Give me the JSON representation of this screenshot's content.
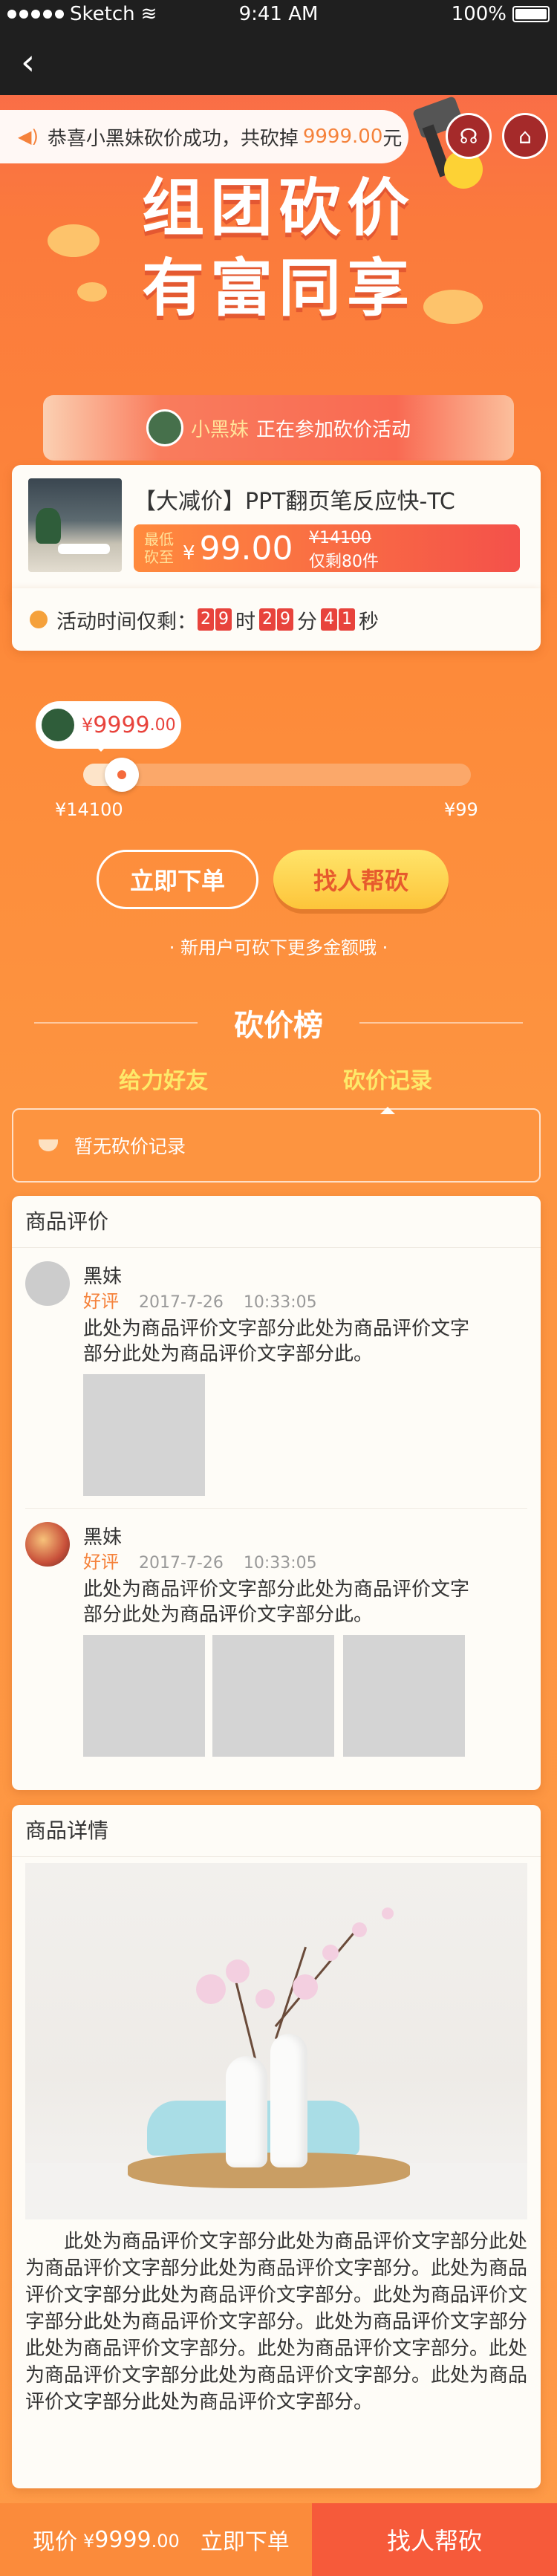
{
  "status_bar": {
    "carrier": "Sketch",
    "time": "9:41 AM",
    "battery": "100%"
  },
  "notice": {
    "text": "恭喜小黑妹砍价成功，共砍掉",
    "amount": "9999.00",
    "unit": "元"
  },
  "hero": {
    "line1": "组团砍价",
    "line2": "有富同享"
  },
  "participant": {
    "name": "小黑妹",
    "text": "正在参加砍价活动"
  },
  "product": {
    "title": "【大减价】PPT翻页笔反应快-TC",
    "lowest_label_1": "最低",
    "lowest_label_2": "砍至",
    "currency": "¥",
    "price": "99.00",
    "original_price": "¥14100",
    "stock": "仅剩80件"
  },
  "timer": {
    "label": "活动时间仅剩：",
    "hours": [
      "2",
      "9"
    ],
    "minutes": [
      "2",
      "9"
    ],
    "seconds": [
      "4",
      "1"
    ],
    "u_hour": "时",
    "u_min": "分",
    "u_sec": "秒"
  },
  "progress": {
    "bubble_currency": "¥",
    "bubble_value": "9999",
    "bubble_decimal": ".00",
    "min_label": "¥14100",
    "max_label": "¥99",
    "fraction": 0.07
  },
  "actions": {
    "buy_now": "立即下单",
    "find_help": "找人帮砍",
    "tip": "新用户可砍下更多金额哦"
  },
  "ranking": {
    "title": "砍价榜",
    "tabs": [
      "给力好友",
      "砍价记录"
    ],
    "empty_text": "暂无砍价记录"
  },
  "reviews": {
    "title": "商品评价",
    "items": [
      {
        "name": "黑妹",
        "rating": "好评",
        "date": "2017-7-26",
        "time": "10:33:05",
        "text": "此处为商品评价文字部分此处为商品评价文字部分此处为商品评价文字部分此。"
      },
      {
        "name": "黑妹",
        "rating": "好评",
        "date": "2017-7-26",
        "time": "10:33:05",
        "text": "此处为商品评价文字部分此处为商品评价文字部分此处为商品评价文字部分此。"
      }
    ]
  },
  "details": {
    "title": "商品详情",
    "text": "此处为商品评价文字部分此处为商品评价文字部分此处为商品评价文字部分此处为商品评价文字部分。此处为商品评价文字部分此处为商品评价文字部分。此处为商品评价文字部分此处为商品评价文字部分。此处为商品评价文字部分此处为商品评价文字部分。此处为商品评价文字部分。此处为商品评价文字部分此处为商品评价文字部分。此处为商品评价文字部分此处为商品评价文字部分。"
  },
  "bottom_bar": {
    "current_label": "现价",
    "currency": "¥",
    "price": "9999",
    "decimal": ".00",
    "buy": "立即下单",
    "help": "找人帮砍"
  },
  "colors": {
    "accent": "#f5823b",
    "red": "#e8433c",
    "yellow": "#fde96a"
  },
  "icons": [
    "back-arrow-icon",
    "speaker-icon",
    "customer-service-icon",
    "shop-icon",
    "clock-icon"
  ]
}
